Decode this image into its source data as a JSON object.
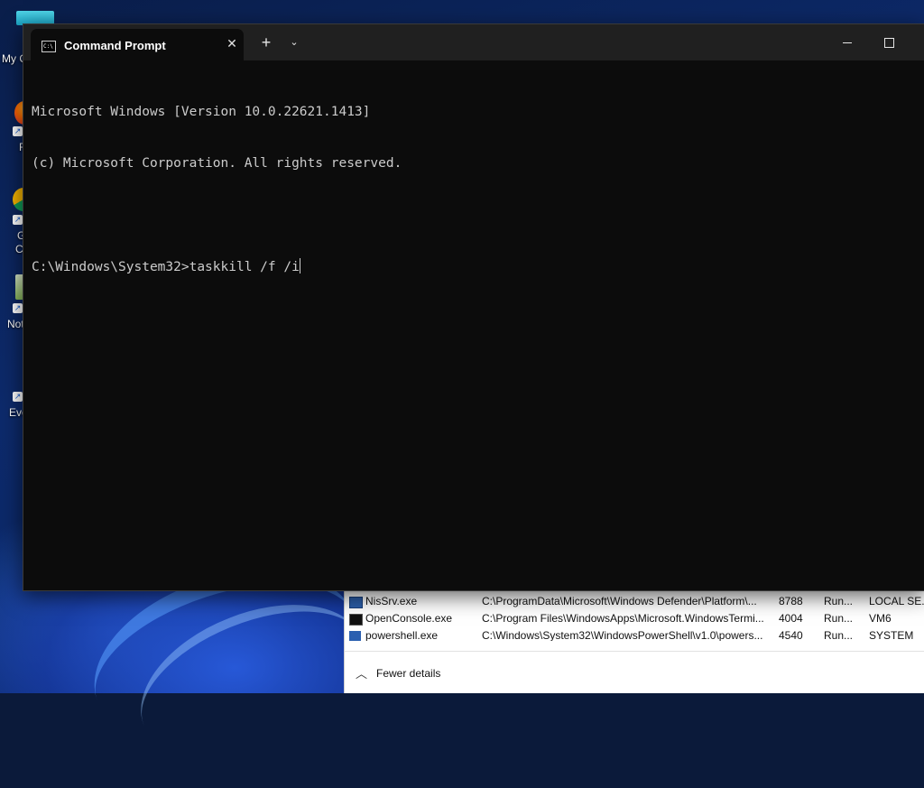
{
  "desktop": {
    "icons": [
      {
        "label": "My C",
        "icon": "this-pc-icon"
      },
      {
        "label": "F",
        "icon": "firefox-icon"
      },
      {
        "label": "G",
        "label2": "C",
        "icon": "chrome-icon"
      },
      {
        "label": "Not",
        "icon": "notepad-icon"
      },
      {
        "label": "Eve",
        "icon": "event-viewer-icon"
      }
    ]
  },
  "terminal": {
    "tab_title": "Command Prompt",
    "tab_icon": "cmd-icon",
    "tab_icon_text": "C:\\",
    "new_tab_glyph": "+",
    "dropdown_glyph": "⌄",
    "close_glyph": "✕",
    "lines": [
      "Microsoft Windows [Version 10.0.22621.1413]",
      "(c) Microsoft Corporation. All rights reserved.",
      "",
      "C:\\Windows\\System32>taskkill /f /i"
    ]
  },
  "task_manager": {
    "rows": [
      {
        "name": "NisSrv.exe",
        "path": "C:\\ProgramData\\Microsoft\\Windows Defender\\Platform\\...",
        "pid": "8788",
        "status": "Run...",
        "user": "LOCAL SE..."
      },
      {
        "name": "OpenConsole.exe",
        "path": "C:\\Program Files\\WindowsApps\\Microsoft.WindowsTermi...",
        "pid": "4004",
        "status": "Run...",
        "user": "VM6"
      },
      {
        "name": "powershell.exe",
        "path": "C:\\Windows\\System32\\WindowsPowerShell\\v1.0\\powers...",
        "pid": "4540",
        "status": "Run...",
        "user": "SYSTEM"
      }
    ],
    "fewer_details": "Fewer details"
  }
}
